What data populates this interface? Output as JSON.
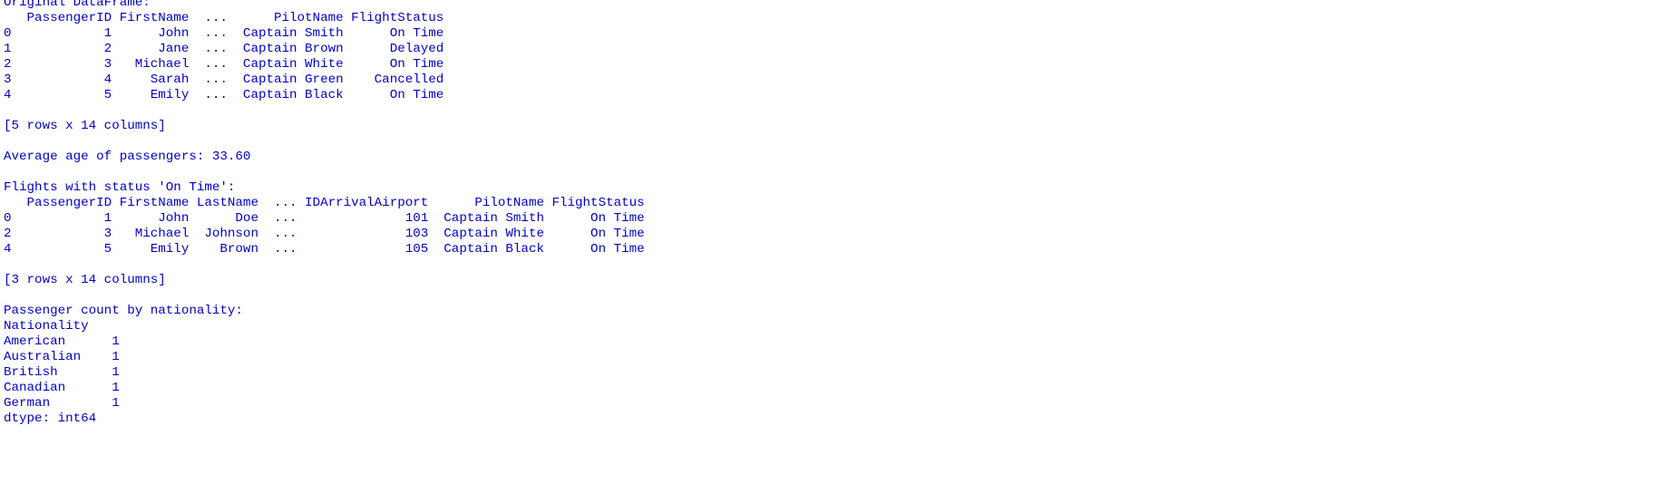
{
  "console": {
    "lines": [
      "Original DataFrame:",
      "   PassengerID FirstName  ...      PilotName FlightStatus",
      "0            1      John  ...  Captain Smith      On Time",
      "1            2      Jane  ...  Captain Brown      Delayed",
      "2            3   Michael  ...  Captain White      On Time",
      "3            4     Sarah  ...  Captain Green    Cancelled",
      "4            5     Emily  ...  Captain Black      On Time",
      "",
      "[5 rows x 14 columns]",
      "",
      "Average age of passengers: 33.60",
      "",
      "Flights with status 'On Time':",
      "   PassengerID FirstName LastName  ... IDArrivalAirport      PilotName FlightStatus",
      "0            1      John      Doe  ...              101  Captain Smith      On Time",
      "2            3   Michael  Johnson  ...              103  Captain White      On Time",
      "4            5     Emily    Brown  ...              105  Captain Black      On Time",
      "",
      "[3 rows x 14 columns]",
      "",
      "Passenger count by nationality:",
      "Nationality",
      "American      1",
      "Australian    1",
      "British       1",
      "Canadian      1",
      "German        1",
      "dtype: int64"
    ]
  }
}
